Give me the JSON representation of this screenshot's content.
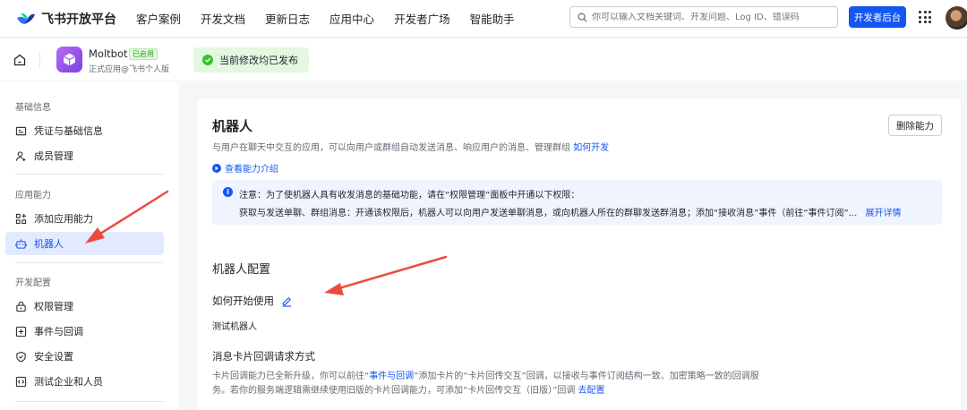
{
  "topnav": {
    "logo": "飞书开放平台",
    "items": [
      "客户案例",
      "开发文档",
      "更新日志",
      "应用中心",
      "开发者广场",
      "智能助手"
    ],
    "search_placeholder": "你可以输入文档关键词、开发问题、Log ID、错误码",
    "dev_console": "开发者后台"
  },
  "app": {
    "name": "Moltbot",
    "badge": "已启用",
    "subtitle": "正式应用@飞书个人版",
    "publish_status": "当前修改均已发布"
  },
  "sidebar": {
    "groups": [
      {
        "title": "基础信息",
        "items": [
          {
            "label": "凭证与基础信息",
            "icon": "id-card-icon"
          },
          {
            "label": "成员管理",
            "icon": "user-add-icon"
          }
        ]
      },
      {
        "title": "应用能力",
        "items": [
          {
            "label": "添加应用能力",
            "icon": "apps-add-icon"
          },
          {
            "label": "机器人",
            "icon": "robot-icon",
            "active": true
          }
        ]
      },
      {
        "title": "开发配置",
        "items": [
          {
            "label": "权限管理",
            "icon": "lock-icon"
          },
          {
            "label": "事件与回调",
            "icon": "plus-box-icon"
          },
          {
            "label": "安全设置",
            "icon": "shield-icon"
          },
          {
            "label": "测试企业和人员",
            "icon": "test-code-icon"
          }
        ]
      }
    ]
  },
  "main": {
    "title": "机器人",
    "description": "与用户在聊天中交互的应用，可以向用户或群组自动发送消息、响应用户的消息、管理群组",
    "how_to_link": "如何开发",
    "intro_link": "查看能力介绍",
    "delete_button": "删除能力",
    "notice_line1": "注意：为了使机器人具有收发消息的基础功能，请在“权限管理”面板中开通以下权限：",
    "notice_line2": "获取与发送单聊、群组消息：开通该权限后，机器人可以向用户发送单聊消息，或向机器人所在的群聊发送群消息；添加“接收消息”事件（前往“事件订阅”...",
    "notice_expand": "展开详情",
    "config_title": "机器人配置",
    "how_to_use_label": "如何开始使用",
    "how_to_use_value": "测试机器人",
    "callback_title": "消息卡片回调请求方式",
    "callback_desc_a": "卡片回调能力已全新升级，你可以前往“",
    "callback_desc_link": "事件与回调",
    "callback_desc_b": "”添加卡片的“卡片回传交互”回调，以接收与事件订阅结构一致、加密策略一致的回调服务。若你的服务端逻辑需继续使用旧版的卡片回调能力，可添加“卡片回传交互（旧版）”回调 ",
    "callback_config_link": "去配置"
  },
  "colors": {
    "accent": "#1456f0",
    "success": "#34c724",
    "arrow": "#ee4b3f"
  }
}
